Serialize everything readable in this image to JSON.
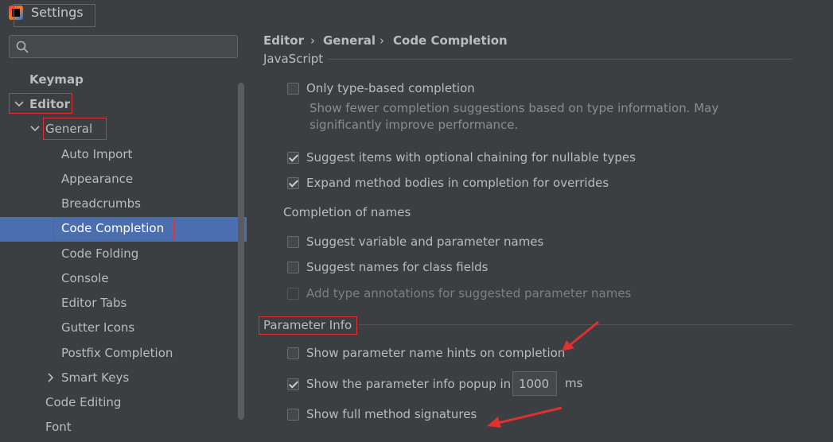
{
  "window": {
    "title": "Settings"
  },
  "search": {
    "placeholder": ""
  },
  "tree": {
    "keymap": "Keymap",
    "editor": "Editor",
    "general": "General",
    "auto_import": "Auto Import",
    "appearance": "Appearance",
    "breadcrumbs": "Breadcrumbs",
    "code_completion": "Code Completion",
    "code_folding": "Code Folding",
    "console": "Console",
    "editor_tabs": "Editor Tabs",
    "gutter_icons": "Gutter Icons",
    "postfix_completion": "Postfix Completion",
    "smart_keys": "Smart Keys",
    "code_editing": "Code Editing",
    "font": "Font"
  },
  "breadcrumb": {
    "items": [
      "Editor",
      "General",
      "Code Completion"
    ],
    "separator": "›"
  },
  "javascript": {
    "section_title": "JavaScript",
    "only_type_based": {
      "label": "Only type-based completion",
      "checked": false
    },
    "only_type_based_desc_1": "Show fewer completion suggestions based on type information. May",
    "only_type_based_desc_2": "significantly improve performance.",
    "optional_chaining": {
      "label": "Suggest items with optional chaining for nullable types",
      "checked": true
    },
    "expand_method_bodies": {
      "label": "Expand method bodies in completion for overrides",
      "checked": true
    }
  },
  "completion_of_names": {
    "title": "Completion of names",
    "variable_names": {
      "label": "Suggest variable and parameter names",
      "checked": false
    },
    "class_fields": {
      "label": "Suggest names for class fields",
      "checked": false
    },
    "type_annotations": {
      "label": "Add type annotations for suggested parameter names",
      "checked": false,
      "disabled": true
    }
  },
  "parameter_info": {
    "section_title": "Parameter Info",
    "name_hints": {
      "label": "Show parameter name hints on completion",
      "checked": false
    },
    "info_popup": {
      "label": "Show the parameter info popup in",
      "checked": true,
      "value": "1000",
      "unit": "ms"
    },
    "full_signatures": {
      "label": "Show full method signatures",
      "checked": false
    }
  },
  "colors": {
    "selection": "#4b6eaf",
    "annotation_red": "#e03030",
    "background": "#3c3f41"
  }
}
